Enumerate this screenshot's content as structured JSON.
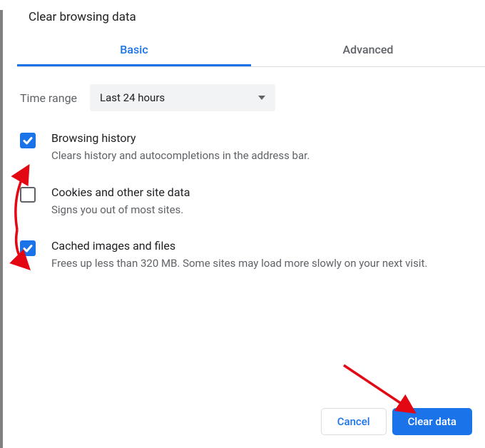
{
  "dialog": {
    "title": "Clear browsing data",
    "tabs": {
      "basic": "Basic",
      "advanced": "Advanced"
    },
    "time_range": {
      "label": "Time range",
      "selected": "Last 24 hours"
    },
    "options": [
      {
        "checked": true,
        "title": "Browsing history",
        "desc": "Clears history and autocompletions in the address bar."
      },
      {
        "checked": false,
        "title": "Cookies and other site data",
        "desc": "Signs you out of most sites."
      },
      {
        "checked": true,
        "title": "Cached images and files",
        "desc": "Frees up less than 320 MB. Some sites may load more slowly on your next visit."
      }
    ],
    "buttons": {
      "cancel": "Cancel",
      "clear": "Clear data"
    }
  }
}
